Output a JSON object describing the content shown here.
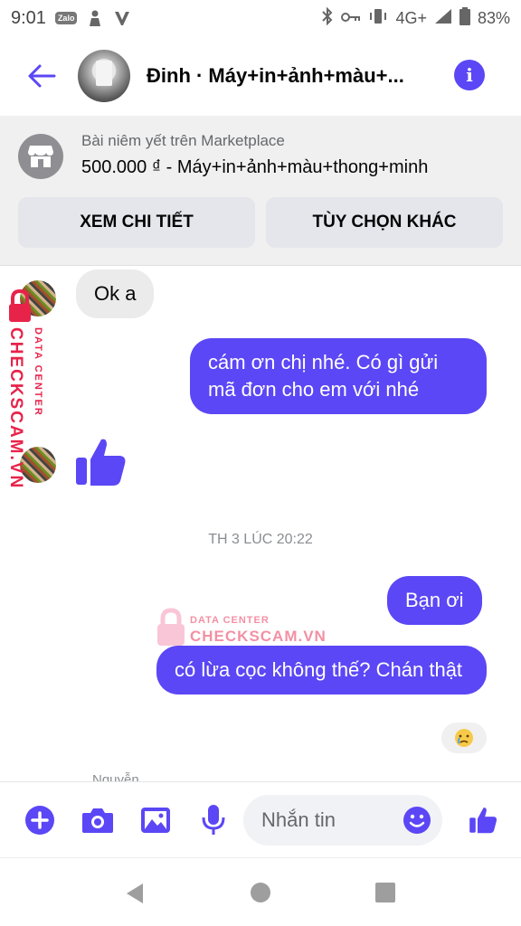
{
  "status": {
    "time": "9:01",
    "app_icons": [
      "zalo-icon",
      "person-icon",
      "v-icon"
    ],
    "network": "4G+",
    "battery": "83%"
  },
  "header": {
    "title": "Đinh · Máy+in+ảnh+màu+...",
    "accent": "#5b47f5"
  },
  "marketplace": {
    "subtitle": "Bài niêm yết trên Marketplace",
    "title": "500.000 ₫ - Máy+in+ảnh+màu+thong+minh",
    "btn_details": "XEM CHI TIẾT",
    "btn_options": "TÙY CHỌN KHÁC"
  },
  "messages": [
    {
      "side": "in",
      "text": "Ok a"
    },
    {
      "side": "out",
      "text": "cám ơn chị nhé. Có gì gửi mã đơn cho em với nhé"
    },
    {
      "side": "in",
      "type": "like"
    },
    {
      "side": "out",
      "text": "Bạn ơi"
    },
    {
      "side": "out",
      "text": "có lừa cọc không thế? Chán thật"
    }
  ],
  "timestamp": "TH 3 LÚC 20:22",
  "reaction": "crying-face-icon",
  "seen_partial": "Nguyễn",
  "watermark": {
    "line1": "DATA CENTER",
    "line2": "CHECKSCAM.VN"
  },
  "composer": {
    "placeholder": "Nhắn tin"
  }
}
